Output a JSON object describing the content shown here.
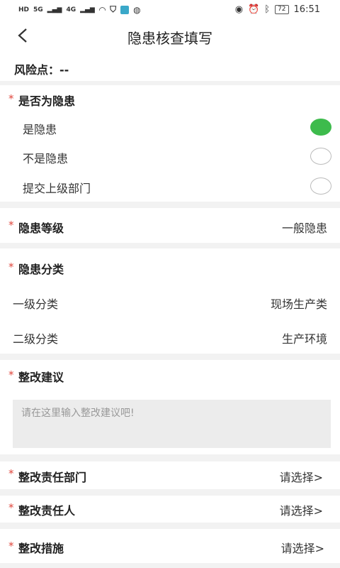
{
  "status_bar": {
    "left_badges": [
      "HD",
      "5G",
      "4G"
    ],
    "time": "16:51",
    "battery": "72"
  },
  "header": {
    "title": "隐患核查填写"
  },
  "risk_point": {
    "label": "风险点：--"
  },
  "is_hazard": {
    "title": "是否为隐患",
    "options": [
      {
        "label": "是隐患",
        "selected": true
      },
      {
        "label": "不是隐患",
        "selected": false
      },
      {
        "label": "提交上级部门",
        "selected": false
      }
    ]
  },
  "hazard_level": {
    "label": "隐患等级",
    "value": "一般隐患"
  },
  "hazard_category": {
    "title": "隐患分类",
    "level1": {
      "label": "一级分类",
      "value": "现场生产类"
    },
    "level2": {
      "label": "二级分类",
      "value": "生产环境"
    }
  },
  "suggestion": {
    "title": "整改建议",
    "placeholder": "请在这里输入整改建议吧!"
  },
  "responsible_dept": {
    "label": "整改责任部门",
    "value": "请选择>"
  },
  "responsible_person": {
    "label": "整改责任人",
    "value": "请选择>"
  },
  "measures": {
    "label": "整改措施",
    "value": "请选择>"
  },
  "required_mark": "*",
  "colors": {
    "accent": "#3dbb4c",
    "required": "#e0463c"
  }
}
